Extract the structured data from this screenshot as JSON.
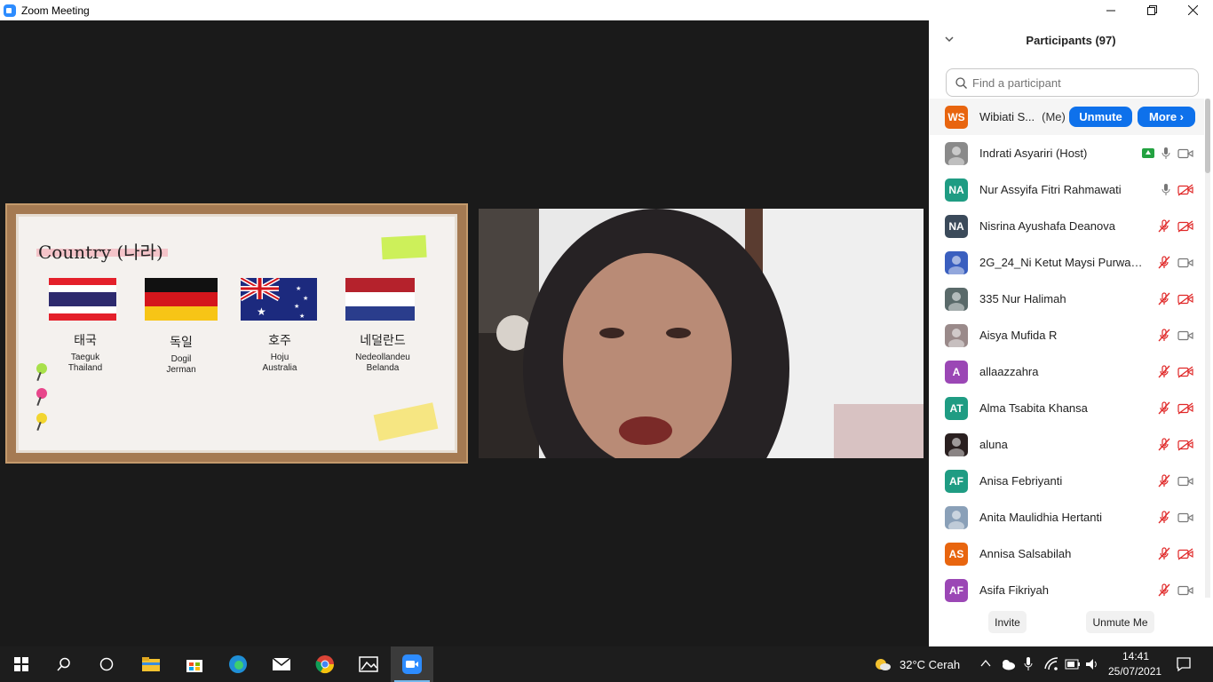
{
  "window": {
    "title": "Zoom Meeting",
    "minimize": "—",
    "maximize": "❐",
    "close": "✕"
  },
  "share": {
    "title": "Country (나라)",
    "countries": [
      {
        "korean": "태국",
        "roman": "Taeguk",
        "indo": "Thailand"
      },
      {
        "korean": "독일",
        "roman": "Dogil",
        "indo": "Jerman"
      },
      {
        "korean": "호주",
        "roman": "Hoju",
        "indo": "Australia"
      },
      {
        "korean": "네덜란드",
        "roman": "Nedeollandeu",
        "indo": "Belanda"
      }
    ]
  },
  "panel": {
    "title": "Participants (97)",
    "search_placeholder": "Find a participant",
    "me": {
      "initials": "WS",
      "name": "Wibiati S...",
      "tag": "(Me)",
      "unmute_label": "Unmute",
      "more_label": "More ›",
      "color": "#e8650f"
    },
    "participants": [
      {
        "initials": "",
        "name": "Indrati Asyariri (Host)",
        "color": "#8a8a8a",
        "photo": true,
        "sharing": true,
        "mic": "on",
        "video": "on"
      },
      {
        "initials": "NA",
        "name": "Nur Assyifa Fitri Rahmawati",
        "color": "#1f9c83",
        "photo": false,
        "sharing": false,
        "mic": "on",
        "video": "off"
      },
      {
        "initials": "NA",
        "name": "Nisrina Ayushafa Deanova",
        "color": "#3b4a5a",
        "photo": false,
        "sharing": false,
        "mic": "off",
        "video": "off"
      },
      {
        "initials": "",
        "name": "2G_24_Ni Ketut Maysi Purwanin...",
        "color": "#3a5fbf",
        "photo": true,
        "sharing": false,
        "mic": "off",
        "video": "on"
      },
      {
        "initials": "",
        "name": "335 Nur Halimah",
        "color": "#5a6a6a",
        "photo": true,
        "sharing": false,
        "mic": "off",
        "video": "off"
      },
      {
        "initials": "",
        "name": "Aisya Mufida R",
        "color": "#9a8a8a",
        "photo": true,
        "sharing": false,
        "mic": "off",
        "video": "on"
      },
      {
        "initials": "A",
        "name": "allaazzahra",
        "color": "#9b47b5",
        "photo": false,
        "sharing": false,
        "mic": "off",
        "video": "off"
      },
      {
        "initials": "AT",
        "name": "Alma Tsabita Khansa",
        "color": "#1f9c83",
        "photo": false,
        "sharing": false,
        "mic": "off",
        "video": "off"
      },
      {
        "initials": "",
        "name": "aluna",
        "color": "#2a2020",
        "photo": true,
        "sharing": false,
        "mic": "off",
        "video": "off"
      },
      {
        "initials": "AF",
        "name": "Anisa Febriyanti",
        "color": "#1f9c83",
        "photo": false,
        "sharing": false,
        "mic": "off",
        "video": "on"
      },
      {
        "initials": "",
        "name": "Anita Maulidhia Hertanti",
        "color": "#8aa0b8",
        "photo": true,
        "sharing": false,
        "mic": "off",
        "video": "on"
      },
      {
        "initials": "AS",
        "name": "Annisa Salsabilah",
        "color": "#e8650f",
        "photo": false,
        "sharing": false,
        "mic": "off",
        "video": "off"
      },
      {
        "initials": "AF",
        "name": "Asifa Fikriyah",
        "color": "#9b47b5",
        "photo": false,
        "sharing": false,
        "mic": "off",
        "video": "on"
      }
    ],
    "invite_label": "Invite",
    "unmute_me_label": "Unmute Me"
  },
  "taskbar": {
    "weather": "32°C  Cerah",
    "time": "14:41",
    "date": "25/07/2021"
  }
}
